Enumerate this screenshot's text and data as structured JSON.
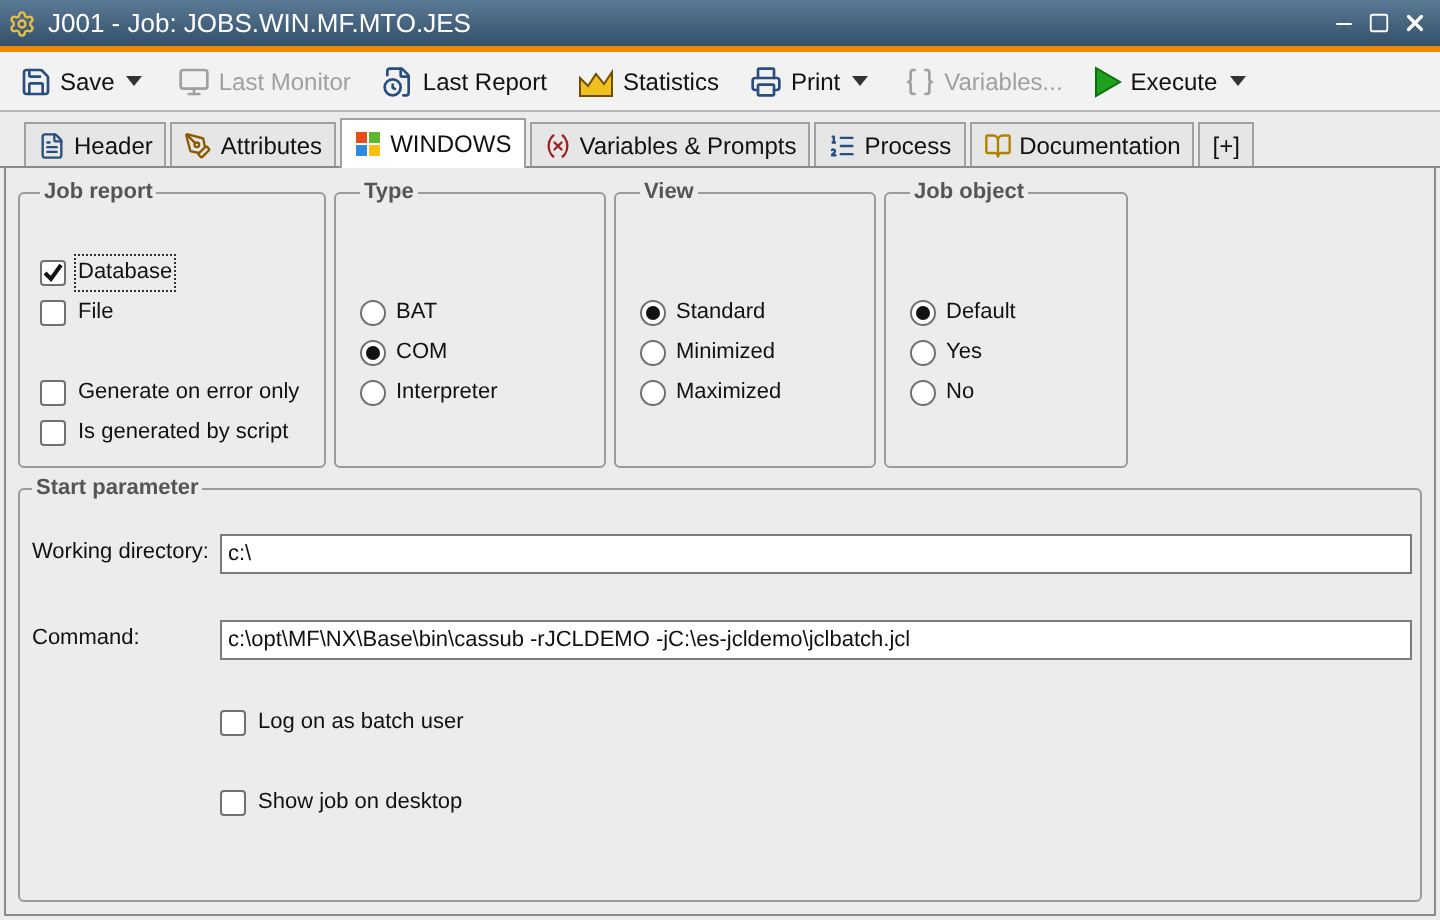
{
  "window": {
    "title": "J001 - Job: JOBS.WIN.MF.MTO.JES"
  },
  "toolbar": [
    {
      "label": "Save",
      "disabled": false,
      "dropdown": true
    },
    {
      "label": "Last Monitor",
      "disabled": true,
      "dropdown": false
    },
    {
      "label": "Last Report",
      "disabled": false,
      "dropdown": false
    },
    {
      "label": "Statistics",
      "disabled": false,
      "dropdown": false
    },
    {
      "label": "Print",
      "disabled": false,
      "dropdown": true
    },
    {
      "label": "Variables...",
      "disabled": true,
      "dropdown": false
    },
    {
      "label": "Execute",
      "disabled": false,
      "dropdown": true
    }
  ],
  "tabs": [
    {
      "label": "Header",
      "selected": false
    },
    {
      "label": "Attributes",
      "selected": false
    },
    {
      "label": "WINDOWS",
      "selected": true
    },
    {
      "label": "Variables & Prompts",
      "selected": false
    },
    {
      "label": "Process",
      "selected": false
    },
    {
      "label": "Documentation",
      "selected": false
    },
    {
      "label": "[+]",
      "selected": false
    }
  ],
  "job_report": {
    "title": "Job report",
    "items": [
      {
        "label": "Database",
        "checked": true,
        "focused": true
      },
      {
        "label": "File",
        "checked": false,
        "focused": false
      },
      {
        "label": "Generate on error only",
        "checked": false,
        "focused": false
      },
      {
        "label": "Is generated by script",
        "checked": false,
        "focused": false
      }
    ]
  },
  "option_groups": [
    {
      "title": "Type",
      "options": [
        {
          "label": "BAT",
          "selected": false
        },
        {
          "label": "COM",
          "selected": true
        },
        {
          "label": "Interpreter",
          "selected": false
        }
      ]
    },
    {
      "title": "View",
      "options": [
        {
          "label": "Standard",
          "selected": true
        },
        {
          "label": "Minimized",
          "selected": false
        },
        {
          "label": "Maximized",
          "selected": false
        }
      ]
    },
    {
      "title": "Job object",
      "options": [
        {
          "label": "Default",
          "selected": true
        },
        {
          "label": "Yes",
          "selected": false
        },
        {
          "label": "No",
          "selected": false
        }
      ]
    }
  ],
  "start_parameter": {
    "title": "Start parameter",
    "fields": [
      {
        "label": "Working directory:",
        "value": "c:\\"
      },
      {
        "label": "Command:",
        "value": "c:\\opt\\MF\\NX\\Base\\bin\\cassub -rJCLDEMO -jC:\\es-jcldemo\\jclbatch.jcl"
      }
    ],
    "checkboxes": [
      {
        "label": "Log on as batch user",
        "checked": false
      },
      {
        "label": "Show job on desktop",
        "checked": false
      }
    ]
  }
}
